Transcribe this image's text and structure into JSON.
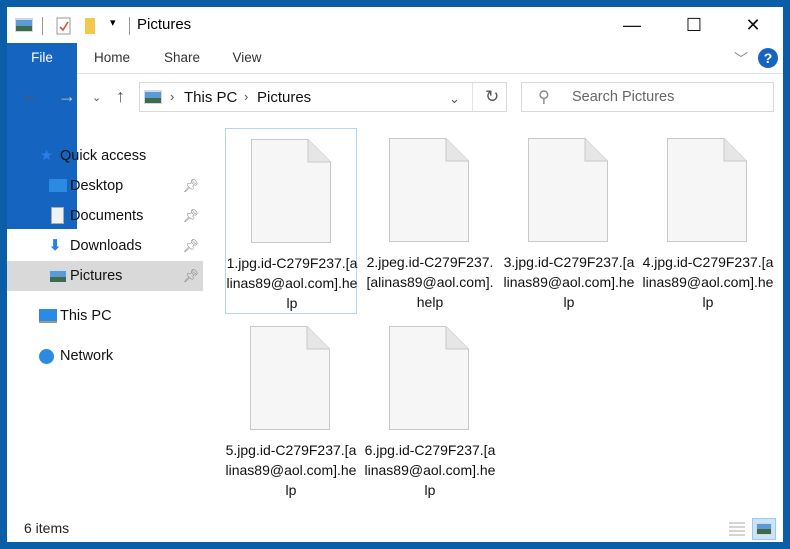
{
  "window": {
    "title": "Pictures",
    "controls": {
      "minimize": "minimize",
      "maximize": "maximize",
      "close": "close"
    }
  },
  "ribbon": {
    "tabs": [
      {
        "label": "File"
      },
      {
        "label": "Home"
      },
      {
        "label": "Share"
      },
      {
        "label": "View"
      }
    ],
    "help": "?"
  },
  "address": {
    "crumbs": [
      "This PC",
      "Pictures"
    ],
    "search_placeholder": "Search Pictures"
  },
  "sidebar": {
    "quick_access": "Quick access",
    "items": [
      {
        "label": "Desktop",
        "pinned": true
      },
      {
        "label": "Documents",
        "pinned": true
      },
      {
        "label": "Downloads",
        "pinned": true
      },
      {
        "label": "Pictures",
        "pinned": true,
        "selected": true
      }
    ],
    "this_pc": "This PC",
    "network": "Network"
  },
  "files": [
    {
      "name": "1.jpg.id-C279F237.[alinas89@aol.com].help",
      "selected": true
    },
    {
      "name": "2.jpeg.id-C279F237.[alinas89@aol.com].help"
    },
    {
      "name": "3.jpg.id-C279F237.[alinas89@aol.com].help"
    },
    {
      "name": "4.jpg.id-C279F237.[alinas89@aol.com].help"
    },
    {
      "name": "5.jpg.id-C279F237.[alinas89@aol.com].help"
    },
    {
      "name": "6.jpg.id-C279F237.[alinas89@aol.com].help"
    }
  ],
  "status": {
    "items": "6 items"
  },
  "colors": {
    "accent": "#1565c0",
    "frame": "#0a5ea8",
    "selected_bg": "#d9d9d9"
  }
}
